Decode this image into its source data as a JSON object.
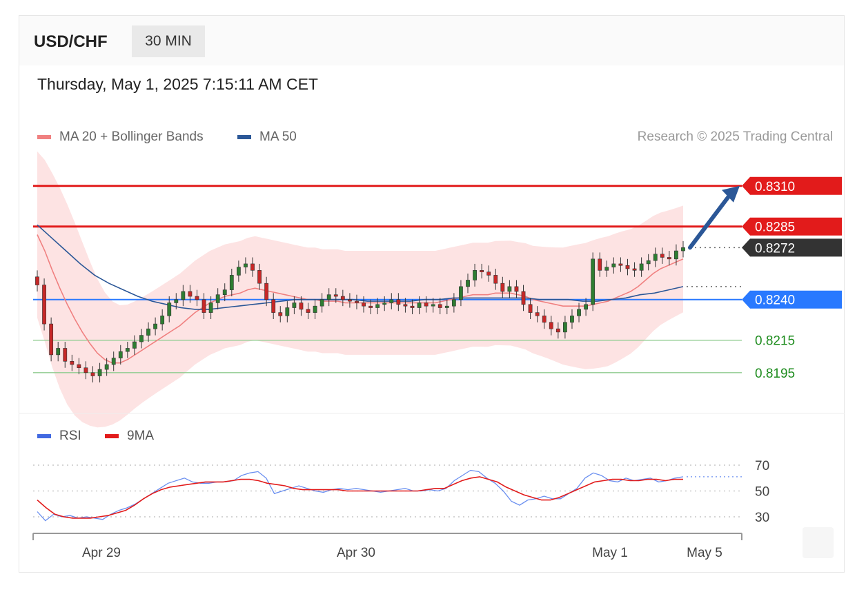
{
  "header": {
    "pair": "USD/CHF",
    "timeframe": "30 MIN",
    "datetime": "Thursday, May 1, 2025 7:15:11 AM CET"
  },
  "legend": {
    "ma20": "MA 20 + Bollinger Bands",
    "ma50": "MA 50",
    "credit": "Research © 2025 Trading Central"
  },
  "rsi_legend": {
    "rsi": "RSI",
    "ma9": "9MA"
  },
  "colors": {
    "ma20": "#f08080",
    "ma50": "#2b5797",
    "resistance": "#e21b1b",
    "pivot": "#2979ff",
    "support": "#1e8c1e",
    "last": "#333333"
  },
  "chart_data": {
    "type": "candlestick",
    "instrument": "USD/CHF",
    "interval": "30 MIN",
    "ylim": [
      0.8172,
      0.8329
    ],
    "x_ticks": [
      "Apr 29",
      "Apr 30",
      "May 1",
      "May 5"
    ],
    "series": [
      {
        "name": "MA 20 + Bollinger Bands"
      },
      {
        "name": "MA 50"
      }
    ],
    "last_price": "0.8272",
    "levels": [
      {
        "value": "0.8310",
        "kind": "resistance"
      },
      {
        "value": "0.8285",
        "kind": "resistance"
      },
      {
        "value": "0.8240",
        "kind": "pivot"
      },
      {
        "value": "0.8215",
        "kind": "support"
      },
      {
        "value": "0.8195",
        "kind": "support"
      }
    ],
    "close": [
      0.8249,
      0.8225,
      0.8206,
      0.821,
      0.8202,
      0.82,
      0.8198,
      0.8195,
      0.8193,
      0.8197,
      0.82,
      0.8204,
      0.8208,
      0.821,
      0.8214,
      0.8218,
      0.8222,
      0.8225,
      0.823,
      0.8238,
      0.824,
      0.8245,
      0.8242,
      0.824,
      0.8232,
      0.8238,
      0.8243,
      0.8246,
      0.8255,
      0.826,
      0.8262,
      0.8258,
      0.825,
      0.824,
      0.8232,
      0.823,
      0.8235,
      0.8238,
      0.8234,
      0.8232,
      0.8236,
      0.824,
      0.8243,
      0.8242,
      0.824,
      0.8239,
      0.8238,
      0.8236,
      0.8235,
      0.8237,
      0.8238,
      0.824,
      0.8237,
      0.8236,
      0.8235,
      0.8238,
      0.8236,
      0.8237,
      0.8235,
      0.8236,
      0.824,
      0.8248,
      0.8252,
      0.8258,
      0.8257,
      0.8255,
      0.825,
      0.8245,
      0.8248,
      0.8245,
      0.8237,
      0.8232,
      0.823,
      0.8226,
      0.8222,
      0.822,
      0.8226,
      0.823,
      0.8234,
      0.8237,
      0.8265,
      0.8258,
      0.826,
      0.8262,
      0.8261,
      0.8259,
      0.8258,
      0.8262,
      0.8264,
      0.8268,
      0.8266,
      0.8265,
      0.827,
      0.8272
    ],
    "ma20": [
      0.828,
      0.827,
      0.8258,
      0.8247,
      0.8237,
      0.8228,
      0.822,
      0.8213,
      0.8207,
      0.8203,
      0.8201,
      0.8201,
      0.8203,
      0.8206,
      0.8209,
      0.8212,
      0.8215,
      0.8218,
      0.8221,
      0.8224,
      0.8228,
      0.8232,
      0.8235,
      0.8238,
      0.824,
      0.8242,
      0.8243,
      0.8244,
      0.8246,
      0.8247,
      0.8246,
      0.8245,
      0.8244,
      0.8243,
      0.8242,
      0.8241,
      0.824,
      0.824,
      0.8239,
      0.8239,
      0.8239,
      0.8238,
      0.8238,
      0.8238,
      0.8238,
      0.8238,
      0.8238,
      0.8238,
      0.8238,
      0.8238,
      0.8238,
      0.8238,
      0.8238,
      0.8238,
      0.8239,
      0.824,
      0.8241,
      0.8242,
      0.8243,
      0.8243,
      0.8243,
      0.8244,
      0.8244,
      0.8244,
      0.8243,
      0.8242,
      0.824,
      0.8239,
      0.8238,
      0.8237,
      0.8236,
      0.8236,
      0.8236,
      0.8236,
      0.8237,
      0.8238,
      0.8239,
      0.8241,
      0.8243,
      0.8245,
      0.8248,
      0.8252,
      0.8256,
      0.8259,
      0.8261,
      0.8263,
      0.8265
    ],
    "ma50": [
      0.8286,
      0.8278,
      0.827,
      0.8262,
      0.8255,
      0.825,
      0.8246,
      0.8242,
      0.8239,
      0.8237,
      0.8235,
      0.8234,
      0.8234,
      0.8235,
      0.8236,
      0.8237,
      0.8238,
      0.8239,
      0.824,
      0.824,
      0.824,
      0.824,
      0.824,
      0.8239,
      0.8239,
      0.8239,
      0.8239,
      0.824,
      0.824,
      0.8241,
      0.8241,
      0.8241,
      0.8241,
      0.8241,
      0.8241,
      0.824,
      0.824,
      0.824,
      0.8239,
      0.8239,
      0.824,
      0.8241,
      0.8243,
      0.8244,
      0.8246,
      0.8248
    ],
    "rsi": [
      34,
      27,
      32,
      30,
      31,
      29,
      30,
      29,
      28,
      32,
      35,
      37,
      40,
      44,
      48,
      52,
      56,
      58,
      60,
      57,
      56,
      56,
      57,
      57,
      58,
      62,
      64,
      65,
      60,
      48,
      50,
      52,
      54,
      52,
      50,
      49,
      51,
      52,
      51,
      52,
      51,
      50,
      49,
      50,
      51,
      52,
      50,
      50,
      51,
      50,
      52,
      58,
      62,
      66,
      65,
      60,
      56,
      50,
      42,
      39,
      43,
      44,
      46,
      44,
      44,
      48,
      52,
      60,
      64,
      62,
      58,
      57,
      60,
      58,
      59,
      60,
      57,
      58,
      60,
      61
    ],
    "rsi_ma9": [
      43,
      37,
      32,
      30,
      29,
      29,
      29,
      30,
      31,
      33,
      35,
      39,
      44,
      48,
      51,
      53,
      54,
      55,
      56,
      57,
      57,
      57,
      58,
      59,
      59,
      58,
      56,
      55,
      54,
      52,
      51,
      51,
      51,
      51,
      51,
      50,
      50,
      50,
      50,
      50,
      50,
      50,
      50,
      50,
      51,
      52,
      52,
      55,
      58,
      60,
      61,
      59,
      57,
      53,
      50,
      47,
      45,
      43,
      43,
      45,
      48,
      51,
      54,
      57,
      58,
      59,
      59,
      58,
      58,
      59,
      59,
      58,
      59,
      59
    ],
    "rsi_levels": [
      "70",
      "50",
      "30"
    ]
  }
}
